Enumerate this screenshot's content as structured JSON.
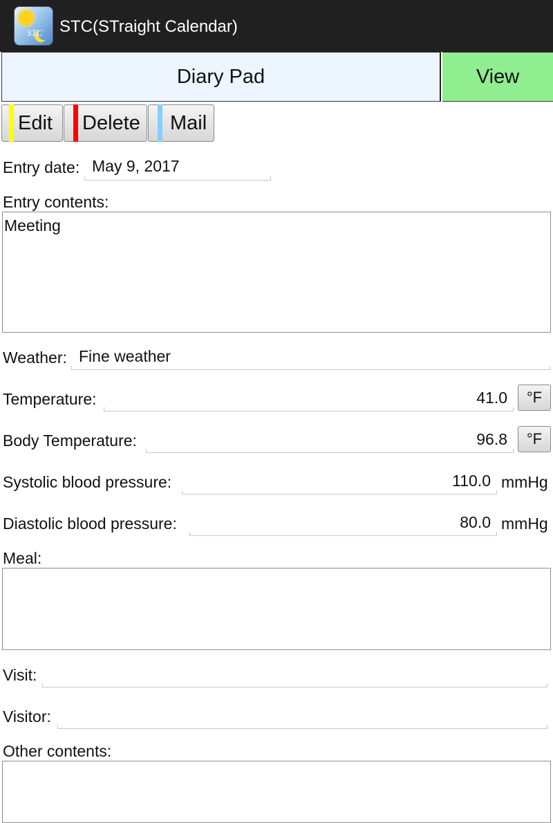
{
  "app": {
    "title": "STC(STraight Calendar)"
  },
  "tabs": {
    "diary_pad": "Diary Pad",
    "view": "View"
  },
  "toolbar": {
    "edit": "Edit",
    "delete": "Delete",
    "mail": "Mail",
    "stripe_colors": {
      "edit": "#ffff00",
      "delete": "#ff0000",
      "mail": "#87cefa"
    }
  },
  "form": {
    "entry_date": {
      "label": "Entry date:",
      "value": "May 9, 2017"
    },
    "entry_contents": {
      "label": "Entry contents:",
      "value": "Meeting"
    },
    "weather": {
      "label": "Weather:",
      "value": "Fine weather"
    },
    "temperature": {
      "label": "Temperature:",
      "value": "41.0",
      "unit": "°F"
    },
    "body_temperature": {
      "label": "Body Temperature:",
      "value": "96.8",
      "unit": "°F"
    },
    "systolic": {
      "label": "Systolic blood pressure:",
      "value": "110.0",
      "unit": "mmHg"
    },
    "diastolic": {
      "label": "Diastolic blood pressure:",
      "value": "80.0",
      "unit": "mmHg"
    },
    "meal": {
      "label": "Meal:",
      "value": ""
    },
    "visit": {
      "label": "Visit:",
      "value": ""
    },
    "visitor": {
      "label": "Visitor:",
      "value": ""
    },
    "other_contents": {
      "label": "Other contents:",
      "value": ""
    }
  }
}
